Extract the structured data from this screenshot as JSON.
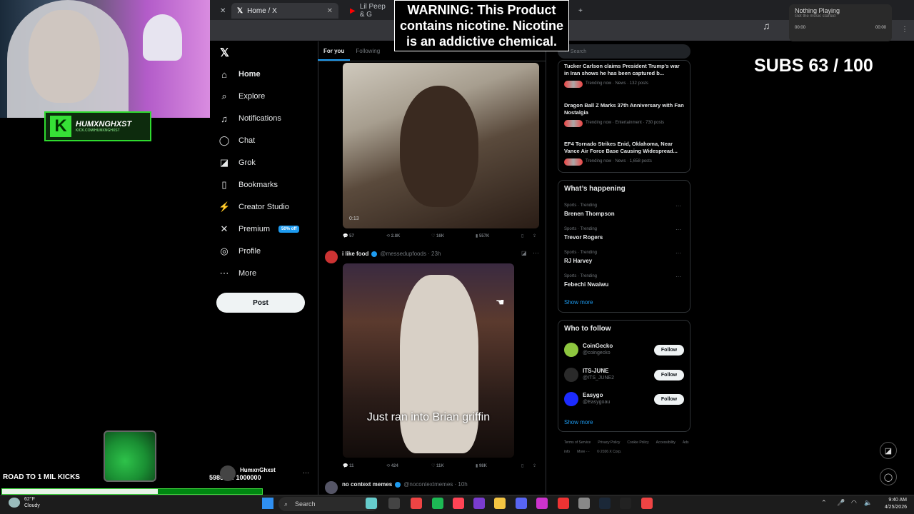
{
  "browser": {
    "tabs": [
      {
        "label": "Home / X",
        "active": true
      },
      {
        "label": "Lil Peep & G",
        "active": false
      }
    ]
  },
  "overlay": {
    "warning": [
      "WARNING: This Product",
      "contains nicotine. Nicotine",
      "is an addictive chemical."
    ],
    "subs": "SUBS 63 / 100",
    "road_label": "ROAD TO 1 MIL KICKS",
    "road_count": "598583 / 1000000",
    "road_progress": 0.598583,
    "streamer_name": "HUMXNGHXST",
    "streamer_url": "KICK.COM/HUMXNGHXST"
  },
  "media_widget": {
    "title": "Nothing Playing",
    "subtitle": "Get the music started",
    "time_start": "00:00",
    "time_end": "00:00"
  },
  "sidebar": {
    "items": [
      {
        "label": "Home",
        "icon": "home-icon",
        "glyph": "⌂"
      },
      {
        "label": "Explore",
        "icon": "search-icon",
        "glyph": "⌕"
      },
      {
        "label": "Notifications",
        "icon": "bell-icon",
        "glyph": "♫"
      },
      {
        "label": "Chat",
        "icon": "chat-icon",
        "glyph": "◯"
      },
      {
        "label": "Grok",
        "icon": "grok-icon",
        "glyph": "◪"
      },
      {
        "label": "Bookmarks",
        "icon": "bookmark-icon",
        "glyph": "▯"
      },
      {
        "label": "Creator Studio",
        "icon": "creator-icon",
        "glyph": "⚡"
      },
      {
        "label": "Premium",
        "icon": "x-icon",
        "glyph": "✕"
      },
      {
        "label": "Profile",
        "icon": "profile-icon",
        "glyph": "◎"
      },
      {
        "label": "More",
        "icon": "more-icon",
        "glyph": "⋯"
      }
    ],
    "premium_badge": "50% off",
    "post_label": "Post",
    "account_name": "HumxnGhxst"
  },
  "feed": {
    "tabs": [
      "For you",
      "Following"
    ],
    "tweet1": {
      "duration": "0:13",
      "replies": "57",
      "reposts": "2.8K",
      "likes": "16K",
      "views": "557K"
    },
    "tweet2": {
      "name": "i like food",
      "handle": "@messedupfoods · 23h",
      "caption": "Just ran into Brian griffin",
      "replies": "11",
      "reposts": "424",
      "likes": "11K",
      "views": "98K"
    },
    "tweet3": {
      "name": "no context memes",
      "handle": "@nocontextmemes · 10h"
    }
  },
  "right": {
    "search_placeholder": "Search",
    "news": [
      {
        "title": "Tucker Carlson claims President Trump's war in Iran shows he has been captured b...",
        "meta": "Trending now · News · 132 posts"
      },
      {
        "title": "Dragon Ball Z Marks 37th Anniversary with Fan Nostalgia",
        "meta": "Trending now · Entertainment · 730 posts"
      },
      {
        "title": "EF4 Tornado Strikes Enid, Oklahoma, Near Vance Air Force Base Causing Widespread...",
        "meta": "Trending now · News · 1,658 posts"
      }
    ],
    "whats_happening": "What’s happening",
    "trends": [
      {
        "meta": "Sports · Trending",
        "name": "Brenen Thompson"
      },
      {
        "meta": "Sports · Trending",
        "name": "Trevor Rogers"
      },
      {
        "meta": "Sports · Trending",
        "name": "RJ Harvey"
      },
      {
        "meta": "Sports · Trending",
        "name": "Febechi Nwaiwu"
      }
    ],
    "show_more": "Show more",
    "who_to_follow": "Who to follow",
    "follow": [
      {
        "name": "CoinGecko",
        "handle": "@coingecko",
        "color": "#8dc63f"
      },
      {
        "name": "ITS-JUNE",
        "handle": "@ITS_JUNE2",
        "color": "#2a2a2a"
      },
      {
        "name": "Easygo",
        "handle": "@Easygoau",
        "color": "#1c2bff"
      }
    ],
    "follow_label": "Follow",
    "footer": [
      "Terms of Service",
      "Privacy Policy",
      "Cookie Policy",
      "Accessibility",
      "Ads info",
      "More ···",
      "© 2026 X Corp."
    ]
  },
  "taskbar": {
    "search": "Search",
    "temp": "62°F",
    "weather": "Cloudy",
    "time": "9:40 AM",
    "date": "4/25/2026"
  }
}
